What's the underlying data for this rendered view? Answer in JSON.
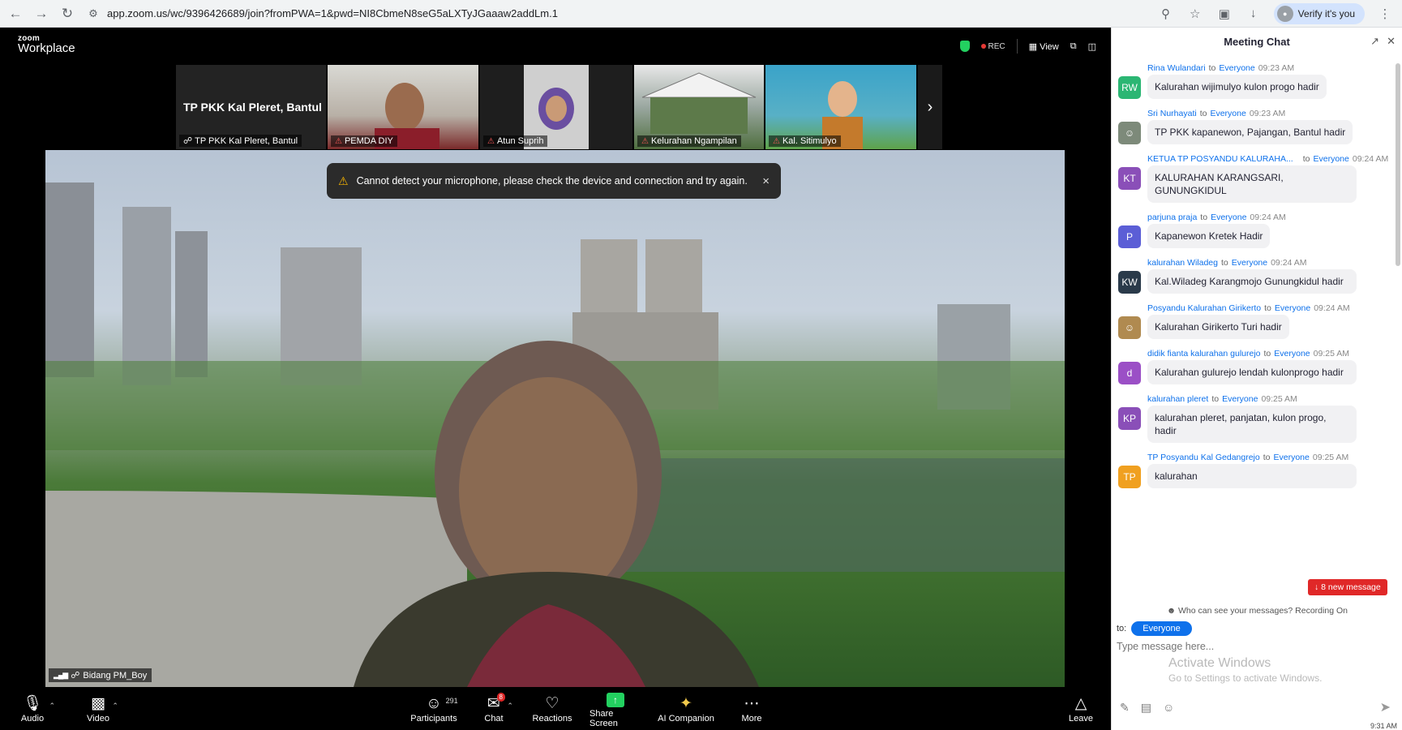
{
  "browser": {
    "url": "app.zoom.us/wc/9396426689/join?fromPWA=1&pwd=NI8CbmeN8seG5aLXTyJGaaaw2addLm.1",
    "verify_label": "Verify it's you"
  },
  "zoom": {
    "logo_small": "zoom",
    "logo_big": "Workplace",
    "rec_label": "REC",
    "view_label": "View"
  },
  "tiles": [
    {
      "big": "TP PKK Kal Pleret, Bantul",
      "name": "TP PKK Kal Pleret, Bantul"
    },
    {
      "name": "PEMDA DIY"
    },
    {
      "name": "Atun Suprih"
    },
    {
      "name": "Kelurahan Ngampilan"
    },
    {
      "name": "Kal. Sitimulyo"
    }
  ],
  "toast": {
    "text": "Cannot detect your microphone, please check the device and connection and try again."
  },
  "speaker": {
    "name": "Bidang PM_Boy"
  },
  "toolbar": {
    "audio": "Audio",
    "video": "Video",
    "participants": "Participants",
    "participants_count": "291",
    "chat": "Chat",
    "chat_badge": "8",
    "reactions": "Reactions",
    "share_screen": "Share Screen",
    "ai_companion": "AI Companion",
    "more": "More",
    "leave": "Leave"
  },
  "chat": {
    "title": "Meeting Chat",
    "to_word": "to",
    "everyone": "Everyone",
    "messages": [
      {
        "sender": "Rina Wulandari",
        "time": "09:23 AM",
        "text": "Kalurahan wijimulyo kulon progo hadir",
        "initials": "RW",
        "color": "#2bb673"
      },
      {
        "sender": "Sri Nurhayati",
        "time": "09:23 AM",
        "text": "TP PKK kapanewon, Pajangan, Bantul hadir",
        "initials": "",
        "color": "#7d8a7a"
      },
      {
        "sender": "KETUA TP POSYANDU KALURAHA...",
        "time": "09:24 AM",
        "text": "KALURAHAN KARANGSARI, GUNUNGKIDUL",
        "initials": "KT",
        "color": "#8a4fb8"
      },
      {
        "sender": "parjuna praja",
        "time": "09:24 AM",
        "text": "Kapanewon Kretek Hadir",
        "initials": "P",
        "color": "#5b5ed6"
      },
      {
        "sender": "kalurahan Wiladeg",
        "time": "09:24 AM",
        "text": "Kal.Wiladeg Karangmojo Gunungkidul hadir",
        "initials": "KW",
        "color": "#2a3a4a"
      },
      {
        "sender": "Posyandu Kalurahan Girikerto",
        "time": "09:24 AM",
        "text": "Kalurahan Girikerto Turi hadir",
        "initials": "",
        "color": "#b08a50"
      },
      {
        "sender": "didik fianta kalurahan gulurejo",
        "time": "09:25 AM",
        "text": "Kalurahan gulurejo lendah kulonprogo hadir",
        "initials": "d",
        "color": "#9b4fc6"
      },
      {
        "sender": "kalurahan pleret",
        "time": "09:25 AM",
        "text": "kalurahan pleret, panjatan, kulon progo, hadir",
        "initials": "KP",
        "color": "#8a4fb8"
      },
      {
        "sender": "TP Posyandu Kal Gedangrejo",
        "time": "09:25 AM",
        "text": "kalurahan",
        "initials": "TP",
        "color": "#f0a020"
      }
    ],
    "new_message": "↓ 8 new message",
    "who_can_see": "Who can see your messages? Recording On",
    "to_label": "to:",
    "to_value": "Everyone",
    "placeholder": "Type message here...",
    "watermark_title": "Activate Windows",
    "watermark_sub": "Go to Settings to activate Windows."
  },
  "clock": "9:31 AM"
}
